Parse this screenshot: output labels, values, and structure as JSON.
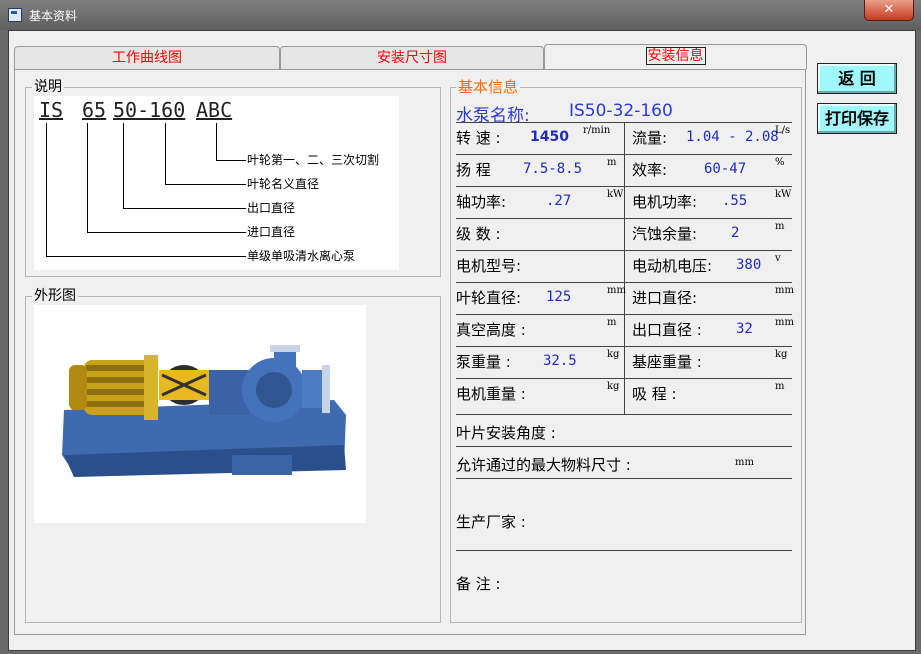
{
  "window": {
    "title": "基本资料",
    "close_glyph": "✕"
  },
  "tabs": [
    {
      "label": "工作曲线图",
      "active": false
    },
    {
      "label": "安装尺寸图",
      "active": false
    },
    {
      "label": "安装信息",
      "active": true
    }
  ],
  "explanation": {
    "group_label": "说明",
    "code_parts": [
      "IS",
      "65",
      "50-160",
      "ABC"
    ],
    "annotations": [
      "叶轮第一、二、三次切割",
      "叶轮名义直径",
      "出口直径",
      "进口直径",
      "单级单吸清水离心泵"
    ]
  },
  "appearance": {
    "group_label": "外形图"
  },
  "basic_info": {
    "title": "基本信息",
    "pump_name_label": "水泵名称:",
    "pump_name_value": "IS50-32-160",
    "rows": [
      {
        "l_label": "转 速 :",
        "l_value": "1450",
        "l_unit": "r/min",
        "r_label": "流量:",
        "r_value": "1.04 - 2.08",
        "r_unit": "L/s"
      },
      {
        "l_label": "扬 程",
        "l_value": "7.5-8.5",
        "l_unit": "m",
        "r_label": "效率:",
        "r_value": "60-47",
        "r_unit": "%"
      },
      {
        "l_label": "轴功率:",
        "l_value": ".27",
        "l_unit": "kW",
        "r_label": "电机功率:",
        "r_value": ".55",
        "r_unit": "kW"
      },
      {
        "l_label": "级 数 :",
        "l_value": "",
        "l_unit": "",
        "r_label": "汽蚀余量:",
        "r_value": "2",
        "r_unit": "m"
      },
      {
        "l_label": "电机型号:",
        "l_value": "",
        "l_unit": "",
        "r_label": "电动机电压:",
        "r_value": "380",
        "r_unit": "v"
      },
      {
        "l_label": "叶轮直径:",
        "l_value": "125",
        "l_unit": "mm",
        "r_label": "进口直径:",
        "r_value": "",
        "r_unit": "mm"
      },
      {
        "l_label": "真空高度 :",
        "l_value": "",
        "l_unit": "m",
        "r_label": "出口直径 :",
        "r_value": "32",
        "r_unit": "mm"
      },
      {
        "l_label": "泵重量 :",
        "l_value": "32.5",
        "l_unit": "kg",
        "r_label": "基座重量 :",
        "r_value": "",
        "r_unit": "kg"
      },
      {
        "l_label": "电机重量 :",
        "l_value": "",
        "l_unit": "kg",
        "r_label": "吸 程 :",
        "r_value": "",
        "r_unit": "m"
      }
    ],
    "blade_angle_label": "叶片安装角度 :",
    "max_material_label": "允许通过的最大物料尺寸 :",
    "max_material_unit": "mm",
    "manufacturer_label": "生产厂家 :",
    "remarks_label": "备 注 :"
  },
  "buttons": {
    "return_label": "返 回",
    "print_save_label": "打印保存"
  }
}
